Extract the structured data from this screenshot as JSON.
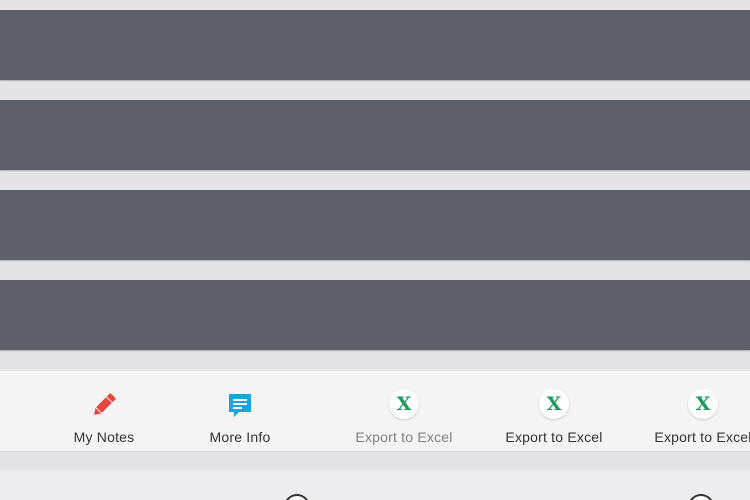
{
  "panels": [
    {
      "id": "panel-1"
    },
    {
      "id": "panel-2"
    },
    {
      "id": "panel-3"
    },
    {
      "id": "panel-4"
    }
  ],
  "toolbar": {
    "items": [
      {
        "label": "My Notes",
        "icon": "pencil-icon",
        "icon_color": "#e8453c",
        "enabled": true
      },
      {
        "label": "More Info",
        "icon": "chat-bubble-icon",
        "icon_color": "#1ba3dc",
        "enabled": true
      },
      {
        "label": "Export to Excel",
        "icon": "excel-icon",
        "icon_color": "#1d9a5b",
        "enabled": false
      },
      {
        "label": "Export to Excel",
        "icon": "excel-icon",
        "icon_color": "#1d9a5b",
        "enabled": true
      },
      {
        "label": "Export to Excel",
        "icon": "excel-icon",
        "icon_color": "#1d9a5b",
        "enabled": true
      }
    ],
    "excel_glyph": "X"
  },
  "colors": {
    "panel": "#5d6068",
    "background": "#e4e4e6",
    "toolbar_bg": "#f4f4f4",
    "label_text": "#333333",
    "disabled_text": "#808080"
  }
}
